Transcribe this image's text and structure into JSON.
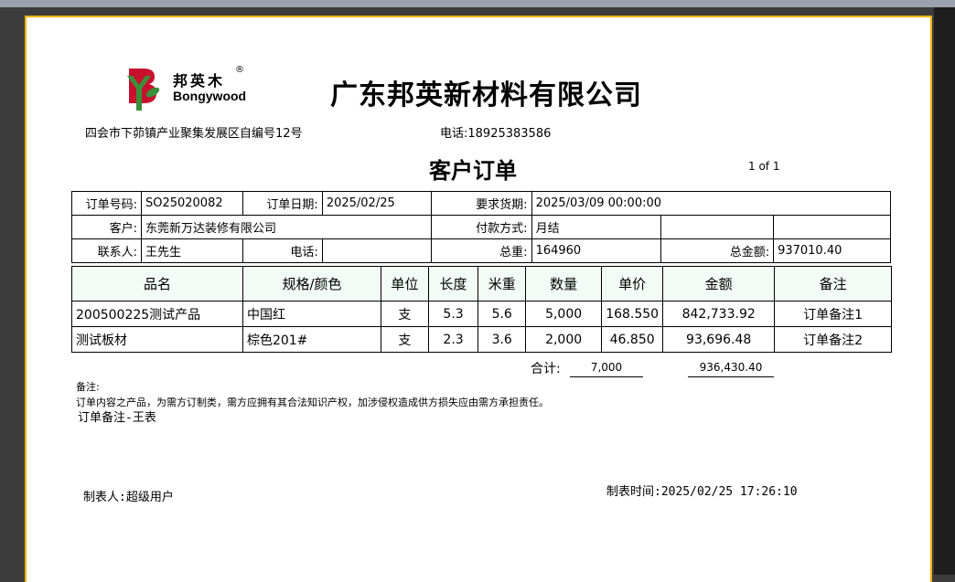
{
  "window": {
    "title_fragment": ""
  },
  "header": {
    "logo_cn": "邦英木",
    "logo_en": "Bongywood",
    "logo_reg": "®",
    "company": "广东邦英新材料有限公司",
    "address": "四会市下茆镇产业聚集发展区自编号12号",
    "phone": "电话:18925383586",
    "title": "客户订单",
    "page": "1 of 1"
  },
  "info": {
    "order_no_label": "订单号码:",
    "order_no": "SO25020082",
    "order_date_label": "订单日期:",
    "order_date": "2025/02/25",
    "delivery_label": "要求货期:",
    "delivery": "2025/03/09 00:00:00",
    "customer_label": "客户:",
    "customer": "东莞新万达装修有限公司",
    "payment_label": "付款方式:",
    "payment": "月结",
    "contact_label": "联系人:",
    "contact": "王先生",
    "tel_label": "电话:",
    "tel": "",
    "weight_label": "总重:",
    "weight": "164960",
    "total_label": "总金额:",
    "total": "937010.40"
  },
  "columns": [
    "品名",
    "规格/颜色",
    "单位",
    "长度",
    "米重",
    "数量",
    "单价",
    "金额",
    "备注"
  ],
  "items": [
    {
      "name": "200500225测试产品",
      "spec": "中国红",
      "unit": "支",
      "length": "5.3",
      "mweight": "5.6",
      "qty": "5,000",
      "price": "168.550",
      "amount": "842,733.92",
      "remark": "订单备注1"
    },
    {
      "name": "测试板材",
      "spec": "棕色201#",
      "unit": "支",
      "length": "2.3",
      "mweight": "3.6",
      "qty": "2,000",
      "price": "46.850",
      "amount": "93,696.48",
      "remark": "订单备注2"
    }
  ],
  "summary": {
    "label": "合计:",
    "qty": "7,000",
    "amount": "936,430.40"
  },
  "notes": {
    "label": "备注:",
    "text": "订单内容之产品，为需方订制类，需方应拥有其合法知识产权，加涉侵权造成供方损失应由需方承担责任。",
    "remark": "订单备注-王表"
  },
  "footer": {
    "maker": "制表人:超级用户",
    "made_time": "制表时间:2025/02/25 17:26:10"
  },
  "colors": {
    "page_border": "#f0b400",
    "header_bg": "#f2fbf6",
    "logo_red": "#c8102e",
    "logo_green": "#3a8f3a"
  }
}
